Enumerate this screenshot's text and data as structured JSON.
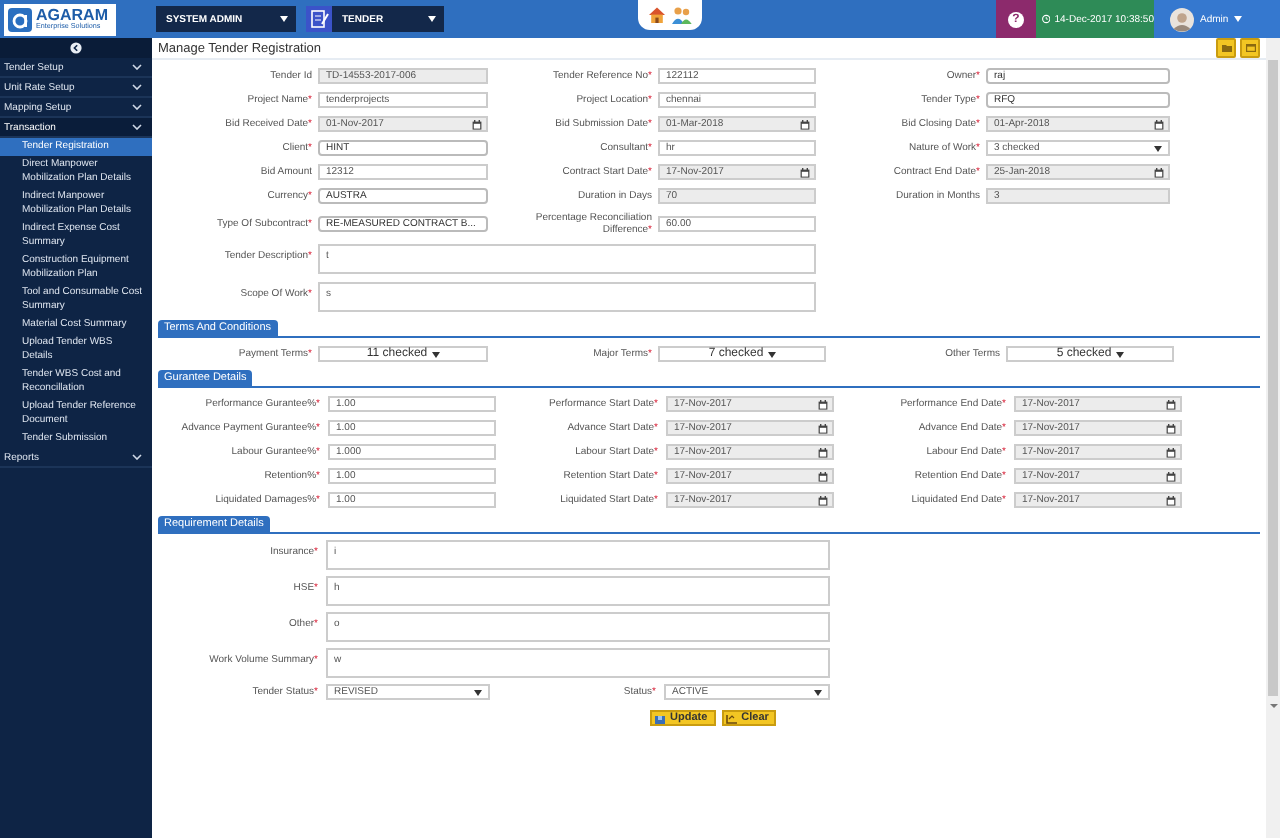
{
  "header": {
    "logo": {
      "name": "AGARAM",
      "tagline": "Enterprise Solutions"
    },
    "role": "SYSTEM ADMIN",
    "module": "TENDER",
    "help": "?",
    "datetime": "14-Dec-2017 10:38:50",
    "user": "Admin"
  },
  "sidebar": {
    "items": [
      {
        "label": "Tender Setup",
        "expanded": false
      },
      {
        "label": "Unit Rate Setup",
        "expanded": false
      },
      {
        "label": "Mapping Setup",
        "expanded": false
      },
      {
        "label": "Transaction",
        "expanded": true,
        "children": [
          {
            "label": "Tender Registration",
            "selected": true
          },
          {
            "label": "Direct Manpower Mobilization Plan Details",
            "selected": false
          },
          {
            "label": "Indirect Manpower Mobilization Plan Details",
            "selected": false
          },
          {
            "label": "Indirect Expense Cost Summary",
            "selected": false
          },
          {
            "label": "Construction Equipment Mobilization Plan",
            "selected": false
          },
          {
            "label": "Tool and Consumable Cost Summary",
            "selected": false
          },
          {
            "label": "Material Cost Summary",
            "selected": false
          },
          {
            "label": "Upload Tender WBS Details",
            "selected": false
          },
          {
            "label": "Tender WBS Cost and Reconcillation",
            "selected": false
          },
          {
            "label": "Upload Tender Reference Document",
            "selected": false
          },
          {
            "label": "Tender Submission",
            "selected": false
          }
        ]
      },
      {
        "label": "Reports",
        "expanded": false
      }
    ]
  },
  "page_title": "Manage Tender Registration",
  "form": {
    "fields": [
      {
        "label": "Tender Id",
        "kind": "readonly",
        "value": "TD-14553-2017-006"
      },
      {
        "label": "Tender Reference No",
        "mark": "*",
        "kind": "text",
        "value": "122112"
      },
      {
        "label": "Owner",
        "mark": "*",
        "kind": "select",
        "value": "raj"
      },
      {
        "label": "Project Name",
        "mark": "*",
        "kind": "text",
        "value": "tenderprojects"
      },
      {
        "label": "Project Location",
        "mark": "*",
        "kind": "text",
        "value": "chennai"
      },
      {
        "label": "Tender Type",
        "mark": "*",
        "kind": "select",
        "value": "RFQ"
      },
      {
        "label": "Bid Received Date",
        "mark": "*",
        "kind": "date",
        "value": "01-Nov-2017"
      },
      {
        "label": "Bid Submission Date",
        "mark": "*",
        "kind": "date",
        "value": "01-Mar-2018"
      },
      {
        "label": "Bid Closing Date",
        "mark": "*",
        "kind": "date",
        "value": "01-Apr-2018"
      },
      {
        "label": "Client",
        "mark": "*",
        "kind": "select",
        "value": "HINT"
      },
      {
        "label": "Consultant",
        "mark": "*",
        "kind": "text",
        "value": "hr"
      },
      {
        "label": "Nature of Work",
        "mark": "*",
        "kind": "dropdown",
        "value": "3 checked"
      },
      {
        "label": "Bid Amount",
        "kind": "text",
        "value": "12312"
      },
      {
        "label": "Contract Start Date",
        "mark": "*",
        "kind": "date",
        "value": "17-Nov-2017"
      },
      {
        "label": "Contract End Date",
        "mark": "*",
        "kind": "date",
        "value": "25-Jan-2018"
      },
      {
        "label": "Currency",
        "mark": "*",
        "kind": "select",
        "value": "AUSTRA"
      },
      {
        "label": "Duration in Days",
        "kind": "readonly",
        "value": "70"
      },
      {
        "label": "Duration in Months",
        "kind": "readonly",
        "value": "3"
      },
      {
        "label": "Type Of Subcontract",
        "mark": "*",
        "kind": "select",
        "value": "RE-MEASURED CONTRACT B..."
      },
      {
        "label": "Percentage Reconciliation Difference",
        "mark": "*",
        "kind": "text",
        "value": "60.00"
      }
    ],
    "descriptions": [
      {
        "label": "Tender Description",
        "mark": "*",
        "kind": "textarea",
        "value": "t"
      },
      {
        "label": "Scope Of Work",
        "mark": "*",
        "kind": "textarea",
        "value": "s"
      }
    ]
  },
  "terms": {
    "title": "Terms And Conditions",
    "fields": [
      {
        "label": "Payment Terms",
        "mark": "*",
        "kind": "multiselect",
        "value": "11 checked"
      },
      {
        "label": "Major Terms",
        "mark": "*",
        "kind": "multiselect",
        "value": "7 checked"
      },
      {
        "label": "Other Terms",
        "kind": "multiselect",
        "value": "5 checked"
      }
    ]
  },
  "guarantee": {
    "title": "Gurantee Details",
    "fields": [
      {
        "label": "Performance Gurantee%",
        "mark": "*",
        "kind": "text",
        "value": "1.00"
      },
      {
        "label": "Performance Start Date",
        "mark": "*",
        "kind": "date",
        "value": "17-Nov-2017"
      },
      {
        "label": "Performance End Date",
        "mark": "*",
        "kind": "date",
        "value": "17-Nov-2017"
      },
      {
        "label": "Advance Payment Gurantee%",
        "mark": "*",
        "kind": "text",
        "value": "1.00"
      },
      {
        "label": "Advance Start Date",
        "mark": "*",
        "kind": "date",
        "value": "17-Nov-2017"
      },
      {
        "label": "Advance End Date",
        "mark": "*",
        "kind": "date",
        "value": "17-Nov-2017"
      },
      {
        "label": "Labour Gurantee%",
        "mark": "*",
        "kind": "text",
        "value": "1.000"
      },
      {
        "label": "Labour Start Date",
        "mark": "*",
        "kind": "date",
        "value": "17-Nov-2017"
      },
      {
        "label": "Labour End Date",
        "mark": "*",
        "kind": "date",
        "value": "17-Nov-2017"
      },
      {
        "label": "Retention%",
        "mark": "*",
        "kind": "text",
        "value": "1.00"
      },
      {
        "label": "Retention Start Date",
        "mark": "*",
        "kind": "date",
        "value": "17-Nov-2017"
      },
      {
        "label": "Retention End Date",
        "mark": "*",
        "kind": "date",
        "value": "17-Nov-2017"
      },
      {
        "label": "Liquidated Damages%",
        "mark": "*",
        "kind": "text",
        "value": "1.00"
      },
      {
        "label": "Liquidated Start Date",
        "mark": "*",
        "kind": "date",
        "value": "17-Nov-2017"
      },
      {
        "label": "Liquidated End Date",
        "mark": "*",
        "kind": "date",
        "value": "17-Nov-2017"
      }
    ]
  },
  "requirement": {
    "title": "Requirement Details",
    "fields": [
      {
        "label": "Insurance",
        "mark": "*",
        "kind": "textarea",
        "value": "i"
      },
      {
        "label": "HSE",
        "mark": "*",
        "kind": "textarea",
        "value": "h"
      },
      {
        "label": "Other",
        "mark": "*",
        "kind": "textarea",
        "value": "o"
      },
      {
        "label": "Work Volume Summary",
        "mark": "*",
        "kind": "textarea",
        "value": "w"
      },
      {
        "label": "Tender Status",
        "mark": "*",
        "kind": "dropdown",
        "value": "REVISED"
      },
      {
        "label": "Status",
        "mark": "*",
        "kind": "dropdown",
        "value": "ACTIVE"
      }
    ]
  },
  "buttons": [
    {
      "label": "Update",
      "kind": "update"
    },
    {
      "label": "Clear",
      "kind": "clear"
    }
  ]
}
